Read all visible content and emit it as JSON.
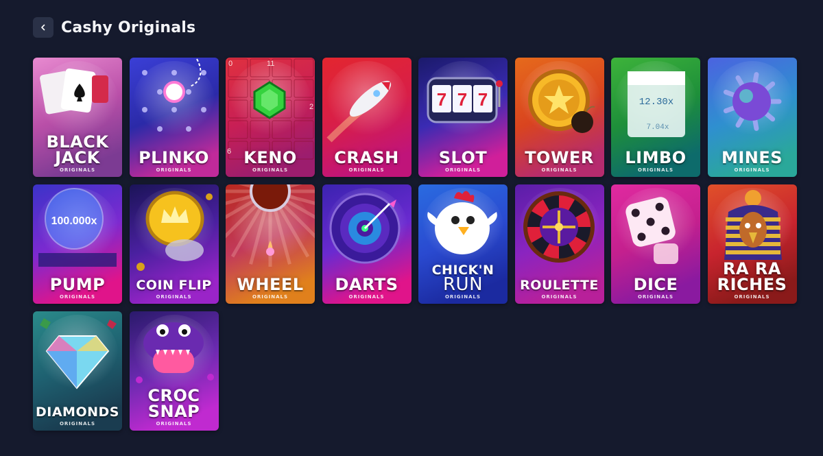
{
  "header": {
    "title": "Cashy Originals",
    "back_icon": "chevron-left-icon"
  },
  "colors": {
    "background": "#151a2d",
    "back_button": "#2a3147"
  },
  "games": [
    {
      "id": "blackjack",
      "title": "BLACK\nJACK",
      "subtitle": "ORIGINALS",
      "icon": "playing-cards-icon",
      "colors": [
        "#e88ad0",
        "#b94fa8",
        "#7c3b93"
      ]
    },
    {
      "id": "plinko",
      "title": "PLINKO",
      "subtitle": "ORIGINALS",
      "icon": "plinko-ball-icon",
      "colors": [
        "#3a3fd6",
        "#2b2aa8",
        "#c02a9a"
      ]
    },
    {
      "id": "keno",
      "title": "KENO",
      "subtitle": "ORIGINALS",
      "icon": "green-gem-icon",
      "colors": [
        "#e0313f",
        "#c81f55",
        "#9c1d6e"
      ],
      "numbers": [
        "0",
        "11",
        "2",
        "6"
      ]
    },
    {
      "id": "crash",
      "title": "CRASH",
      "subtitle": "ORIGINALS",
      "icon": "rocket-icon",
      "colors": [
        "#e3262f",
        "#d81e48",
        "#c0147a"
      ]
    },
    {
      "id": "slot",
      "title": "SLOT",
      "subtitle": "ORIGINALS",
      "icon": "slot-machine-icon",
      "colors": [
        "#1b1a6b",
        "#3a2bb3",
        "#d01f9a"
      ],
      "reels": [
        "7",
        "7",
        "7"
      ]
    },
    {
      "id": "tower",
      "title": "TOWER",
      "subtitle": "ORIGINALS",
      "icon": "star-coin-bomb-icon",
      "colors": [
        "#e66a1c",
        "#d9441f",
        "#b62b6e"
      ]
    },
    {
      "id": "limbo",
      "title": "LIMBO",
      "subtitle": "ORIGINALS",
      "icon": "ice-cube-icon",
      "colors": [
        "#3db33a",
        "#1e8f3a",
        "#0d6b6b"
      ],
      "multipliers": [
        "12.30x",
        "7.04x"
      ]
    },
    {
      "id": "mines",
      "title": "MINES",
      "subtitle": "ORIGINALS",
      "icon": "spiked-mine-icon",
      "colors": [
        "#4b63e0",
        "#2f8fd0",
        "#2aa89a"
      ]
    },
    {
      "id": "pump",
      "title": "PUMP",
      "subtitle": "ORIGINALS",
      "icon": "balloon-icon",
      "colors": [
        "#3b33c9",
        "#7c2ad0",
        "#e0148a"
      ],
      "multiplier": "100.000x"
    },
    {
      "id": "coin-flip",
      "title": "COIN FLIP",
      "subtitle": "ORIGINALS",
      "icon": "crown-coin-icon",
      "colors": [
        "#1b1458",
        "#4a20a0",
        "#9a24c8"
      ]
    },
    {
      "id": "wheel",
      "title": "WHEEL",
      "subtitle": "ORIGINALS",
      "icon": "fortune-wheel-icon",
      "colors": [
        "#b8281f",
        "#c23a5a",
        "#e0801c"
      ]
    },
    {
      "id": "darts",
      "title": "DARTS",
      "subtitle": "ORIGINALS",
      "icon": "dartboard-icon",
      "colors": [
        "#3b23b0",
        "#6a2ad0",
        "#e0148a"
      ]
    },
    {
      "id": "chicken-run",
      "title": "CHICK'N",
      "title2": "RUN",
      "subtitle": "ORIGINALS",
      "icon": "chicken-icon",
      "colors": [
        "#2a6be0",
        "#2a4ad0",
        "#1b2aa0"
      ]
    },
    {
      "id": "roulette",
      "title": "ROULETTE",
      "subtitle": "ORIGINALS",
      "icon": "roulette-wheel-icon",
      "colors": [
        "#5a1ea8",
        "#8a24c0",
        "#b8209a"
      ]
    },
    {
      "id": "dice",
      "title": "DICE",
      "subtitle": "ORIGINALS",
      "icon": "dice-icon",
      "colors": [
        "#e02aa0",
        "#c4208e",
        "#8a1aa0"
      ]
    },
    {
      "id": "ra-ra-riches",
      "title": "RA RA\nRICHES",
      "subtitle": "ORIGINALS",
      "icon": "pharaoh-falcon-icon",
      "colors": [
        "#e0502a",
        "#c8242e",
        "#8a1a1a"
      ]
    },
    {
      "id": "diamonds",
      "title": "DIAMONDS",
      "subtitle": "ORIGINALS",
      "icon": "diamond-icon",
      "colors": [
        "#2a8a8a",
        "#1e6070",
        "#1a3c50"
      ]
    },
    {
      "id": "croc-snap",
      "title": "CROC\nSNAP",
      "subtitle": "ORIGINALS",
      "icon": "crocodile-icon",
      "colors": [
        "#2a1a6b",
        "#6a2ab0",
        "#c02ad0"
      ]
    }
  ]
}
